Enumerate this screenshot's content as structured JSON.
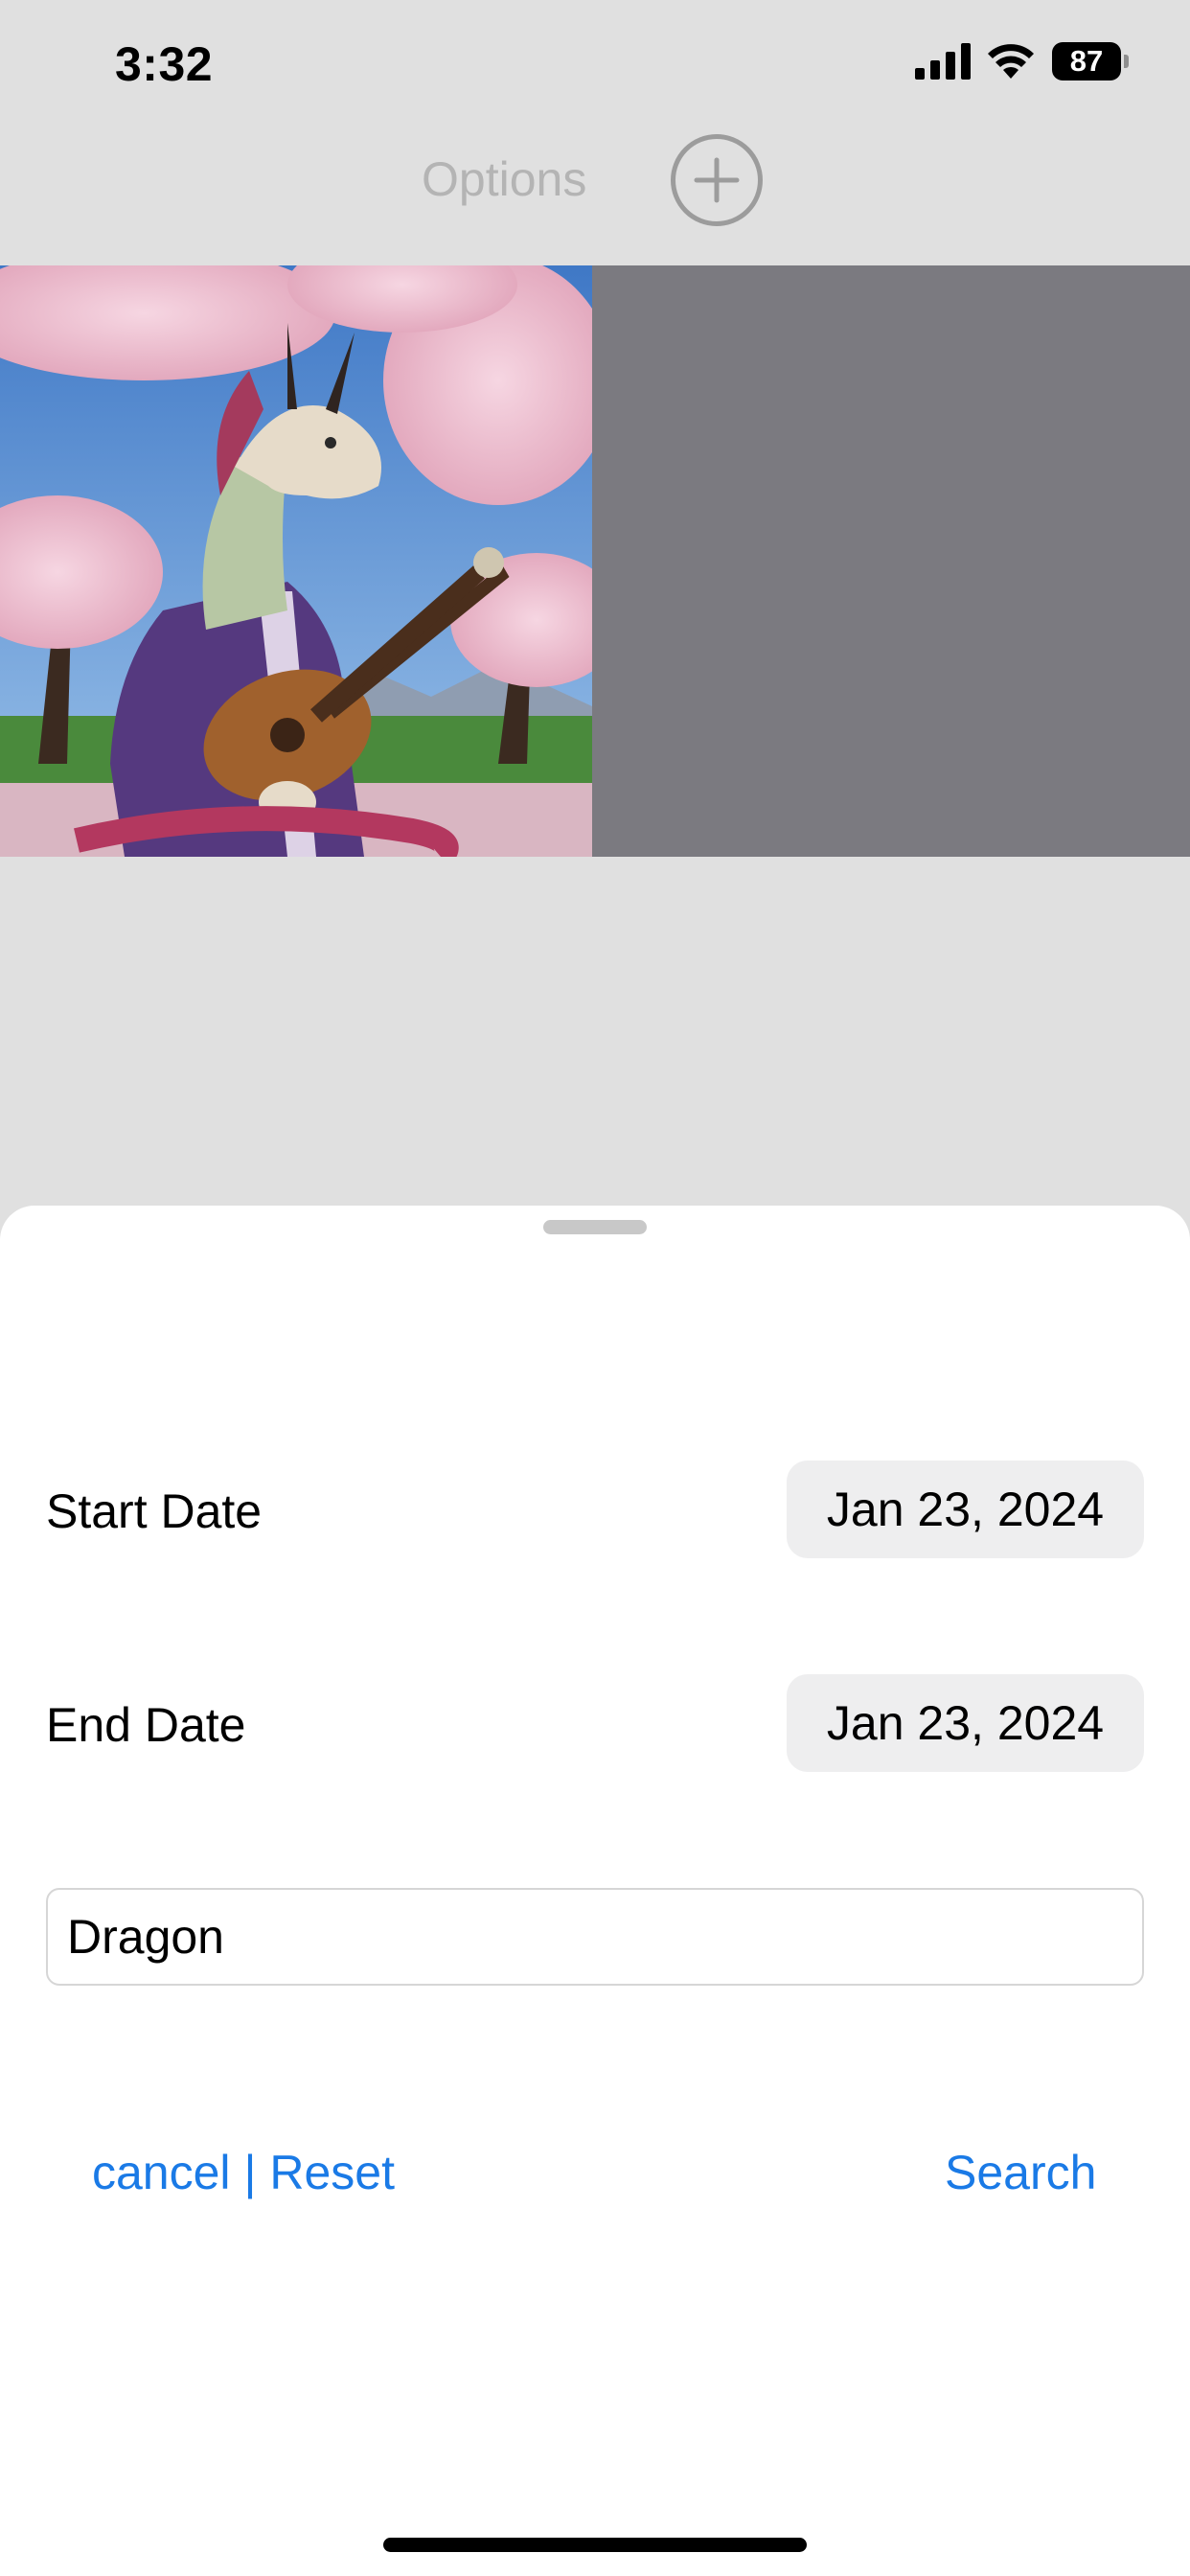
{
  "status_bar": {
    "time": "3:32",
    "battery": "87",
    "signal_icon": "cellular-signal-icon",
    "wifi_icon": "wifi-icon"
  },
  "nav": {
    "options_label": "Options",
    "add_icon": "plus-circle-icon"
  },
  "gallery": {
    "items": [
      {
        "kind": "image",
        "subject": "dragon-playing-guitar-under-cherry-blossoms"
      }
    ]
  },
  "filter_sheet": {
    "start_date_label": "Start Date",
    "start_date_value": "Jan 23, 2024",
    "end_date_label": "End Date",
    "end_date_value": "Jan 23, 2024",
    "search_text": "Dragon",
    "cancel_label": "cancel",
    "separator": "|",
    "reset_label": "Reset",
    "search_label": "Search"
  },
  "colors": {
    "accent": "#1a7ae6",
    "background": "#e0e0e0",
    "placeholder_tile": "#7b7a80"
  }
}
